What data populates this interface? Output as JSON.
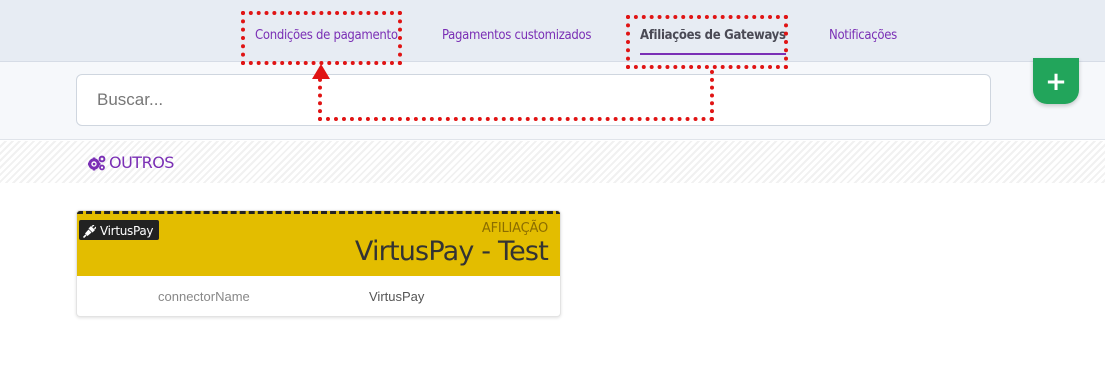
{
  "tabs": [
    {
      "label": "Condições de pagamento",
      "active": false
    },
    {
      "label": "Pagamentos customizados",
      "active": false
    },
    {
      "label": "Afiliações de Gateways",
      "active": true
    },
    {
      "label": "Notificações",
      "active": false
    }
  ],
  "search": {
    "placeholder": "Buscar..."
  },
  "add_button": {
    "icon": "plus-icon",
    "color": "#22a55b"
  },
  "section": {
    "icon": "gears-icon",
    "title": "OUTROS"
  },
  "card": {
    "badge_icon": "plug-icon",
    "badge": "VirtusPay",
    "type": "AFILIAÇÃO",
    "name": "VirtusPay - Test",
    "header_color": "#e3bd00",
    "fields": [
      {
        "key": "connectorName",
        "value": "VirtusPay"
      }
    ]
  },
  "colors": {
    "accent": "#7a2fb5",
    "annotation": "#e01414"
  }
}
